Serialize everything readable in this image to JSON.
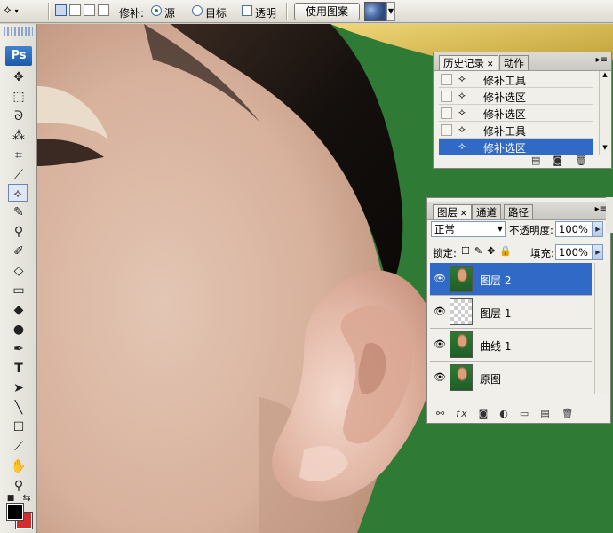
{
  "options_bar": {
    "tool_icon": "patch-tool-icon",
    "patch_label": "修补:",
    "source_label": "源",
    "destination_label": "目标",
    "transparent_label": "透明",
    "use_pattern_label": "使用图案",
    "selected_patch_mode": "source"
  },
  "toolbox": {
    "logo": "Ps",
    "foreground_color": "#000000",
    "background_color": "#d42d2d"
  },
  "history_panel": {
    "tab_history": "历史记录",
    "tab_actions": "动作",
    "items": [
      {
        "label": "修补工具",
        "icon": "patch-tool-icon",
        "selected": false
      },
      {
        "label": "修补选区",
        "icon": "patch-tool-icon",
        "selected": false
      },
      {
        "label": "修补选区",
        "icon": "patch-tool-icon",
        "selected": false
      },
      {
        "label": "修补工具",
        "icon": "patch-tool-icon",
        "selected": false
      },
      {
        "label": "修补选区",
        "icon": "patch-tool-icon",
        "selected": true
      }
    ]
  },
  "layers_panel": {
    "tab_layers": "图层",
    "tab_channels": "通道",
    "tab_paths": "路径",
    "blend_mode": "正常",
    "opacity_label": "不透明度:",
    "opacity_value": "100%",
    "lock_label": "锁定:",
    "fill_label": "填充:",
    "fill_value": "100%",
    "layers": [
      {
        "name": "图层 2",
        "thumb": "photo",
        "selected": true
      },
      {
        "name": "图层 1",
        "thumb": "transparent",
        "selected": false
      },
      {
        "name": "曲线 1",
        "thumb": "photo",
        "selected": false
      },
      {
        "name": "原图",
        "thumb": "photo",
        "selected": false
      }
    ]
  },
  "colors": {
    "selection_blue": "#3169c6",
    "canvas_green": "#2f7a35",
    "skin": "#d9b6a2"
  }
}
